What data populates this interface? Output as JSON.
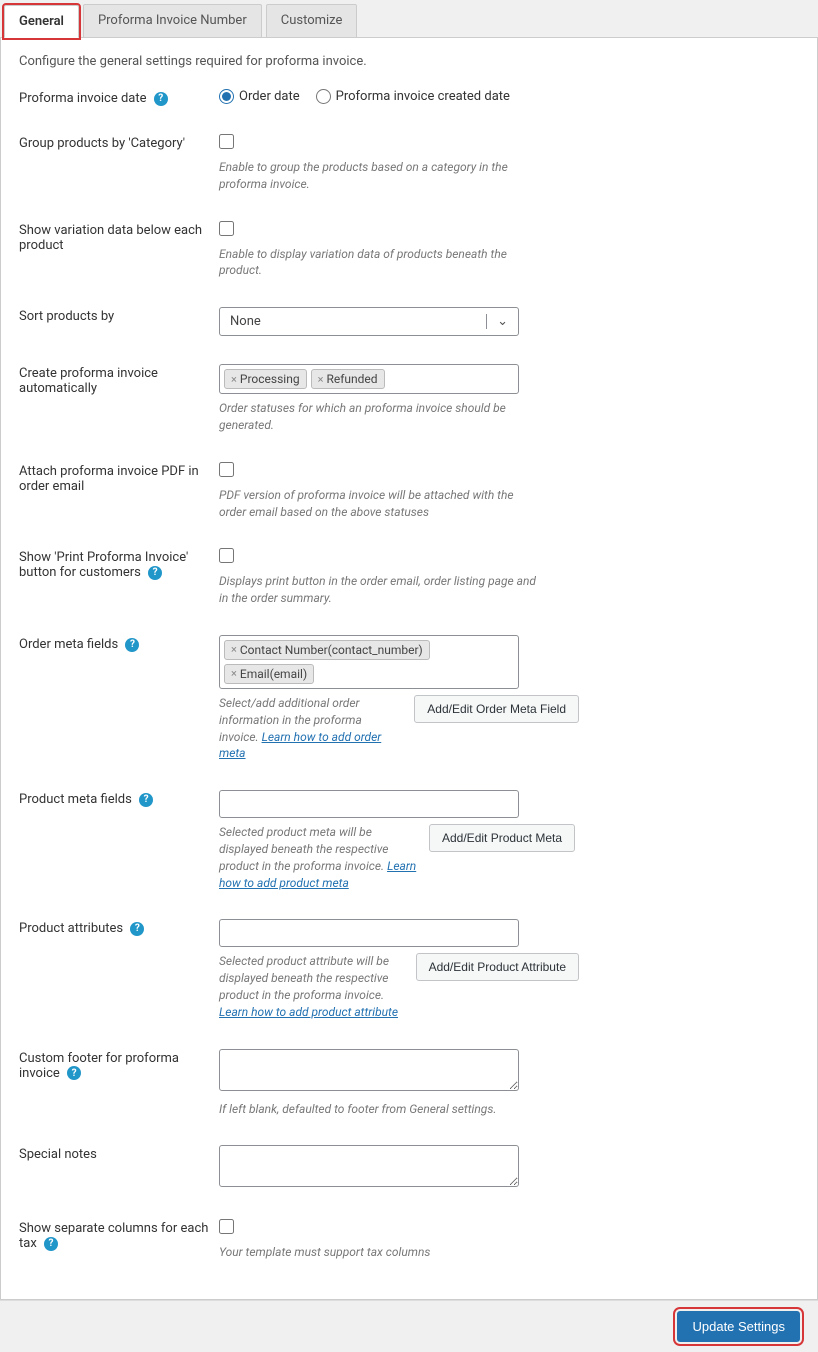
{
  "tabs": {
    "general": "General",
    "number": "Proforma Invoice Number",
    "customize": "Customize"
  },
  "intro": "Configure the general settings required for proforma invoice.",
  "fields": {
    "date": {
      "label": "Proforma invoice date",
      "opt1": "Order date",
      "opt2": "Proforma invoice created date"
    },
    "group": {
      "label": "Group products by 'Category'",
      "desc": "Enable to group the products based on a category in the proforma invoice."
    },
    "variation": {
      "label": "Show variation data below each product",
      "desc": "Enable to display variation data of products beneath the product."
    },
    "sort": {
      "label": "Sort products by",
      "selected": "None"
    },
    "auto": {
      "label": "Create proforma invoice automatically",
      "tags": [
        "Processing",
        "Refunded"
      ],
      "desc": "Order statuses for which an proforma invoice should be generated."
    },
    "attach": {
      "label": "Attach proforma invoice PDF in order email",
      "desc": "PDF version of proforma invoice will be attached with the order email based on the above statuses"
    },
    "printbtn": {
      "label": "Show 'Print Proforma Invoice' button for customers",
      "desc": "Displays print button in the order email, order listing page and in the order summary."
    },
    "ordermeta": {
      "label": "Order meta fields",
      "tags": [
        "Contact Number(contact_number)",
        "Email(email)"
      ],
      "desc": "Select/add additional order information in the proforma invoice.",
      "link": "Learn how to add order meta",
      "button": "Add/Edit Order Meta Field"
    },
    "productmeta": {
      "label": "Product meta fields",
      "desc": "Selected product meta will be displayed beneath the respective product in the proforma invoice.",
      "link": "Learn how to add product meta",
      "button": "Add/Edit Product Meta"
    },
    "productattr": {
      "label": "Product attributes",
      "desc": "Selected product attribute will be displayed beneath the respective product in the proforma invoice.",
      "link": "Learn how to add product attribute",
      "button": "Add/Edit Product Attribute"
    },
    "footer": {
      "label": "Custom footer for proforma invoice",
      "desc": "If left blank, defaulted to footer from General settings."
    },
    "notes": {
      "label": "Special notes"
    },
    "taxcol": {
      "label": "Show separate columns for each tax",
      "desc": "Your template must support tax columns"
    }
  },
  "buttons": {
    "update": "Update Settings"
  }
}
